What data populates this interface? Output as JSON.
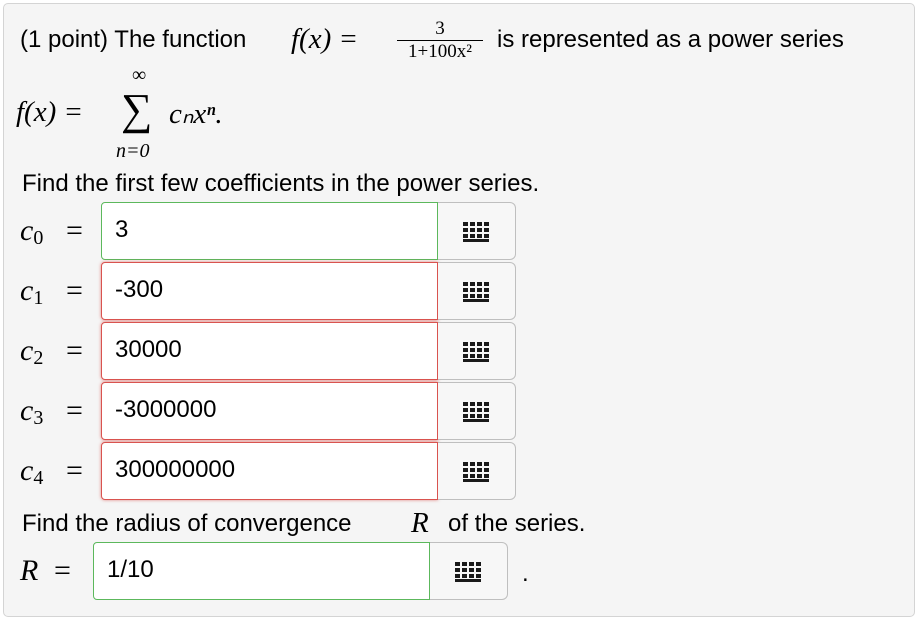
{
  "problem": {
    "prefix": "(1 point) The function",
    "fx": "f(x) =",
    "frac_num": "3",
    "frac_den": "1+100x²",
    "suffix": "is represented as a power series",
    "series_lhs": "f(x) =",
    "sum_top": "∞",
    "sum_symbol": "∑",
    "sum_bottom": "n=0",
    "series_term": "cₙxⁿ.",
    "find_coeffs": "Find the first few coefficients in the power series.",
    "find_radius": "Find the radius of convergence",
    "radius_var": "R",
    "radius_suffix": "of the series.",
    "period": "."
  },
  "coefficients": [
    {
      "label": "c",
      "sub": "0",
      "eq": "=",
      "value": "3",
      "status": "correct"
    },
    {
      "label": "c",
      "sub": "1",
      "eq": "=",
      "value": "-300",
      "status": "incorrect"
    },
    {
      "label": "c",
      "sub": "2",
      "eq": "=",
      "value": "30000",
      "status": "incorrect"
    },
    {
      "label": "c",
      "sub": "3",
      "eq": "=",
      "value": "-3000000",
      "status": "incorrect"
    },
    {
      "label": "c",
      "sub": "4",
      "eq": "=",
      "value": "300000000",
      "status": "incorrect"
    }
  ],
  "radius": {
    "label": "R",
    "eq": "=",
    "value": "1/10",
    "status": "correct"
  },
  "icons": {
    "keypad": "keypad-icon"
  },
  "colors": {
    "correct": "#5cb85c",
    "incorrect": "#d9534f"
  }
}
